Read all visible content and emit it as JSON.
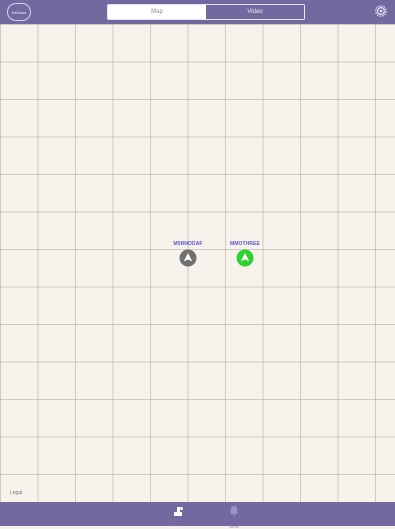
{
  "header": {
    "brand": "DeNosa",
    "tabs": [
      {
        "label": "Map",
        "active": true
      },
      {
        "label": "Video",
        "active": false
      }
    ],
    "settings_icon": "gear-icon"
  },
  "map": {
    "vessels": [
      {
        "name": "M0RNODAF",
        "color": "#6f6f6f"
      },
      {
        "name": "MMOTHREE",
        "color": "#2fd12f"
      }
    ],
    "legal_label": "Legal"
  },
  "tabbar": {
    "items": [
      {
        "label": "Monitor",
        "icon": "ship-icon",
        "active": true
      },
      {
        "label": "Alerts",
        "icon": "bell-icon",
        "active": false
      }
    ]
  },
  "colors": {
    "bar": "#7468a0",
    "map_bg": "#f7f3ec",
    "label": "#5d55c7"
  }
}
